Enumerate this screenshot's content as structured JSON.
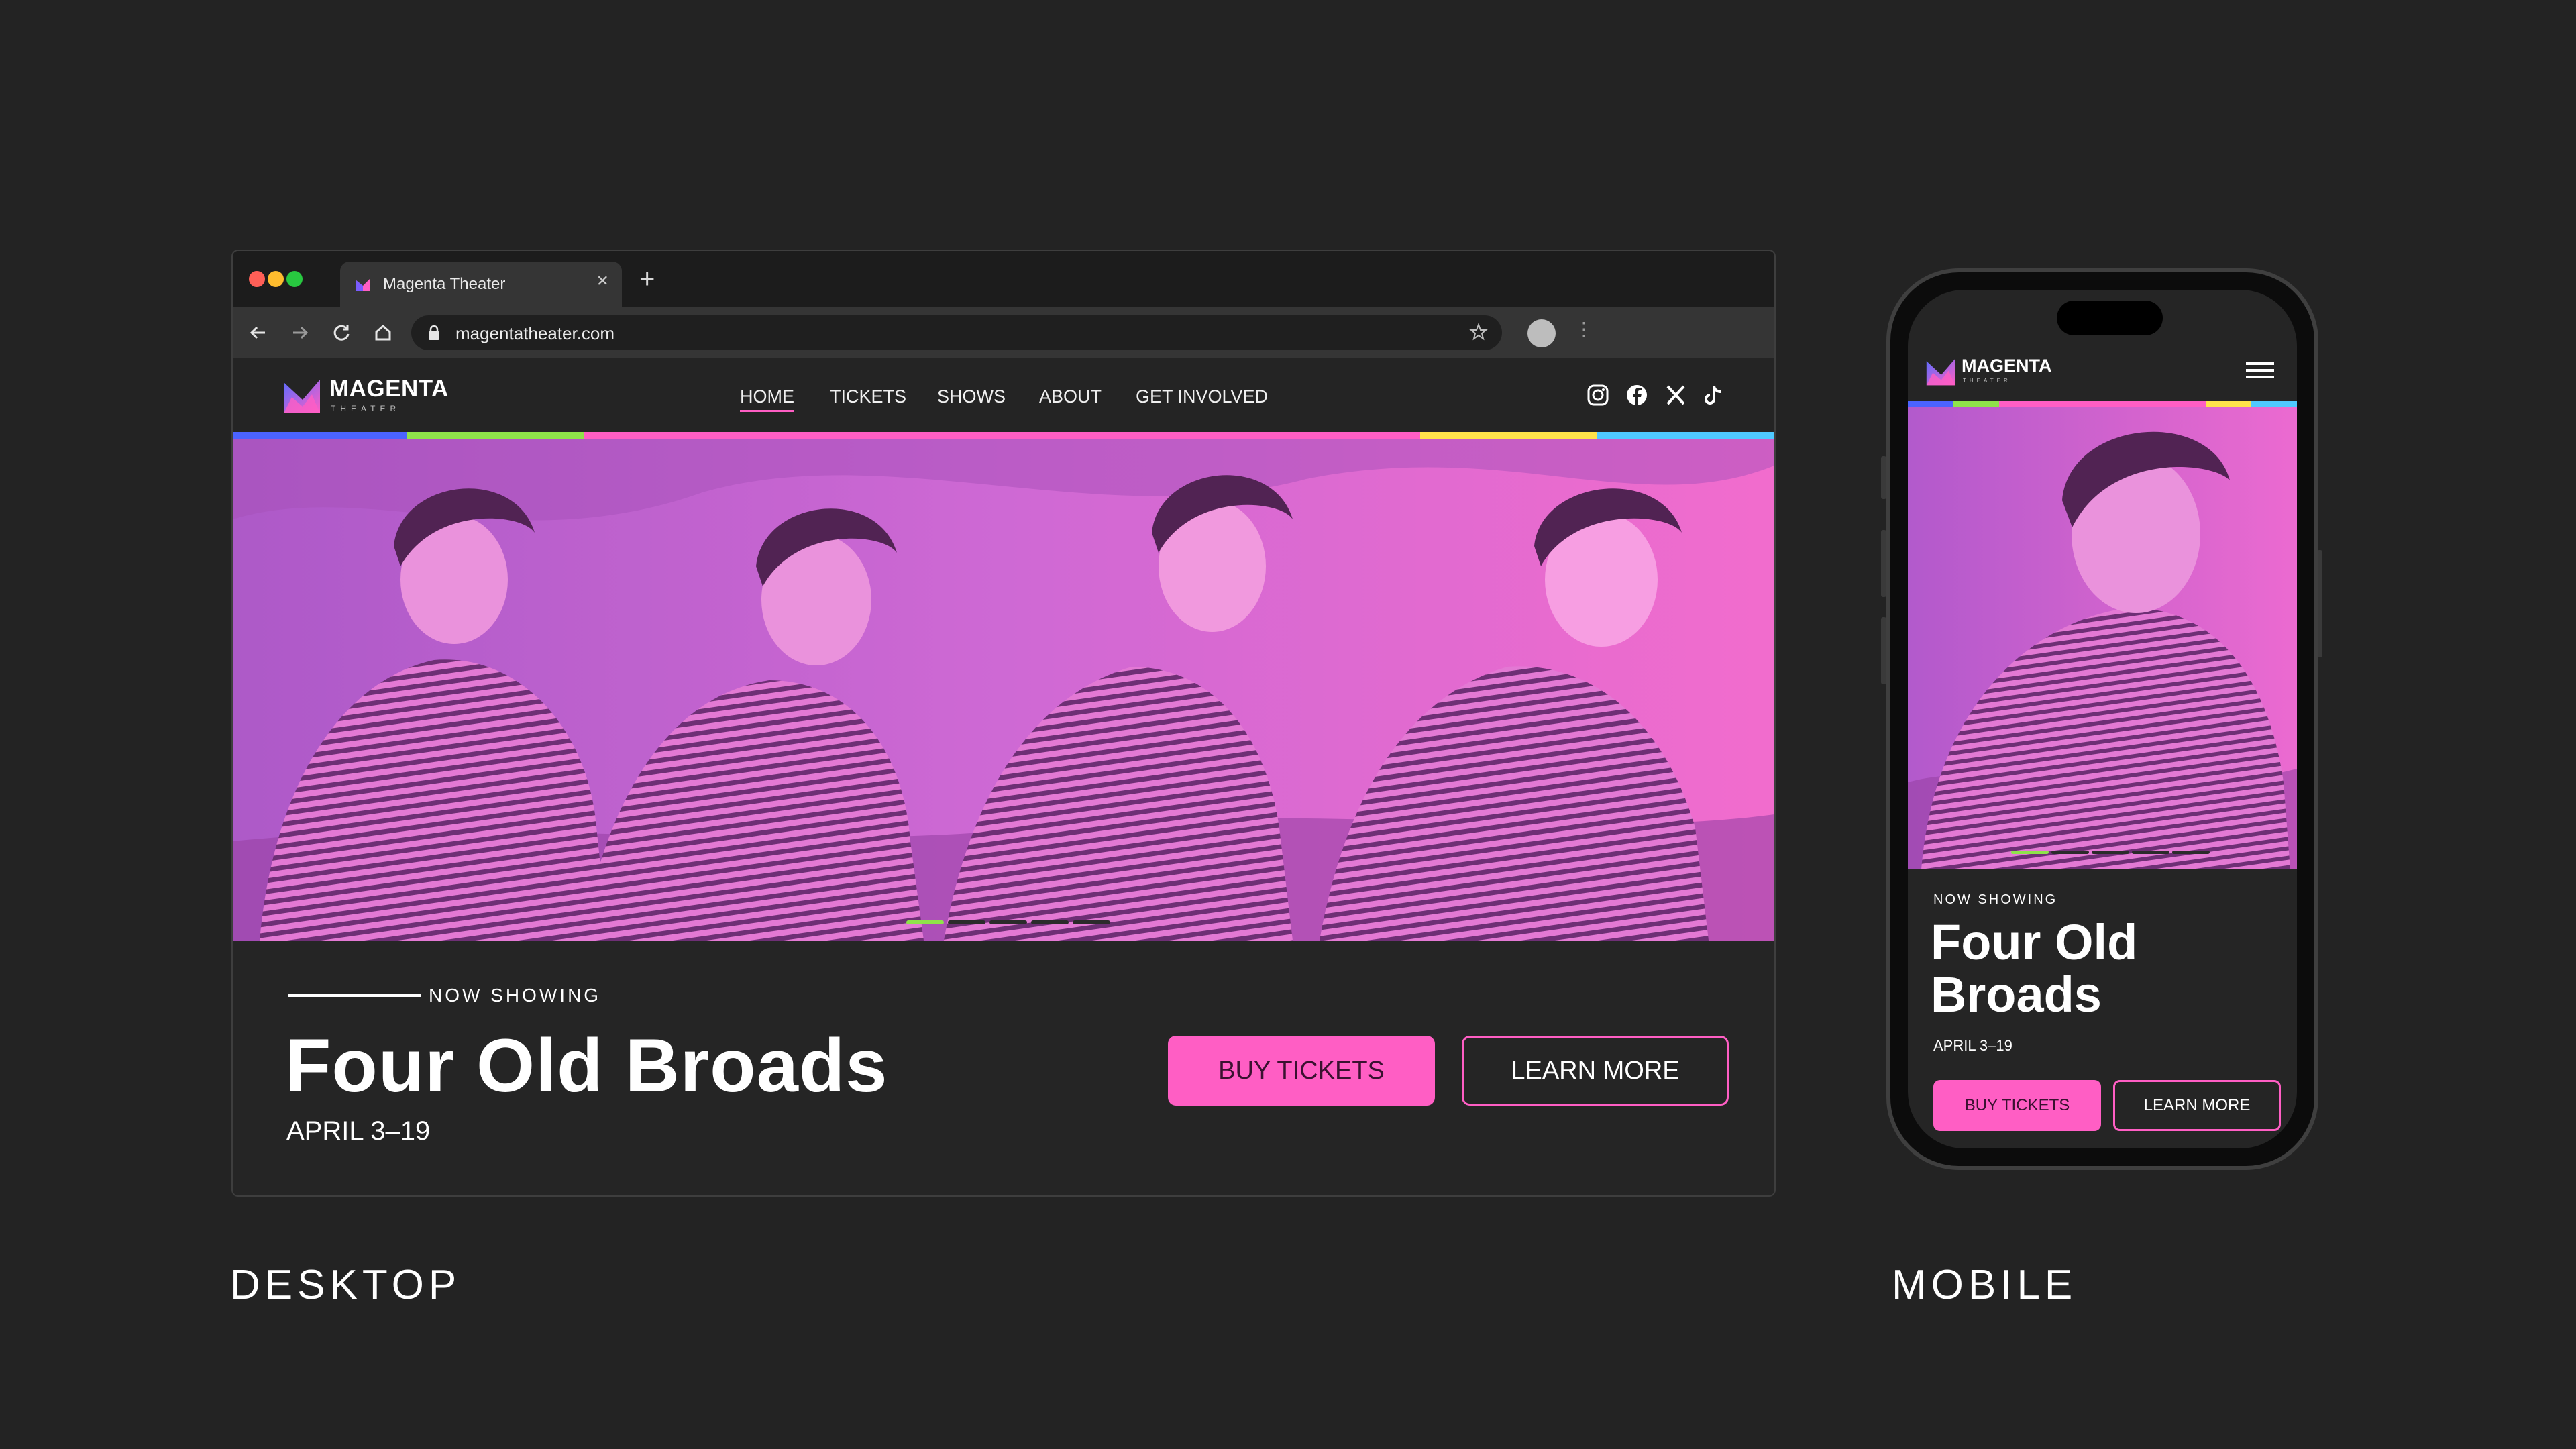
{
  "browser": {
    "tab_title": "Magenta Theater",
    "url": "magentatheater.com"
  },
  "site": {
    "logo_name": "MAGENTA",
    "logo_sub": "THEATER",
    "nav": [
      "HOME",
      "TICKETS",
      "SHOWS",
      "ABOUT",
      "GET INVOLVED"
    ],
    "active_nav": "HOME",
    "social_icons": [
      "instagram-icon",
      "facebook-icon",
      "x-icon",
      "tiktok-icon"
    ],
    "strip_colors": [
      "#4b63ff",
      "#8fe34a",
      "#ff5ec4",
      "#ffe34a",
      "#4fc9ff"
    ],
    "accent": "#ff5ec4"
  },
  "hero": {
    "now_showing": "NOW SHOWING",
    "title": "Four Old Broads",
    "dates": "APRIL 3–19",
    "buy_label": "BUY TICKETS",
    "learn_label": "LEARN MORE",
    "slides_total": 5,
    "slide_active": 1
  },
  "mobile": {
    "now_showing": "NOW SHOWING",
    "title": "Four Old Broads",
    "dates": "APRIL 3–19",
    "buy_label": "BUY TICKETS",
    "learn_label": "LEARN MORE"
  },
  "captions": {
    "desktop": "DESKTOP",
    "mobile": "MOBILE"
  }
}
